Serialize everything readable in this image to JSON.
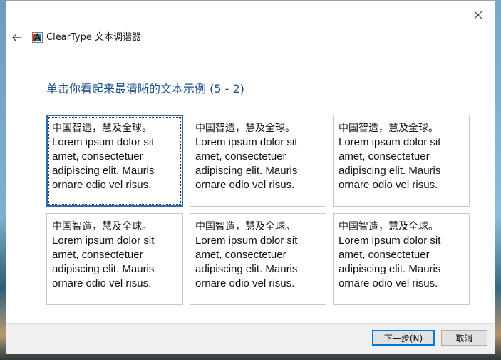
{
  "window": {
    "title": "ClearType 文本调谐器",
    "icon": "cleartype-app-icon",
    "back_icon": "back-arrow-icon",
    "close_icon": "close-icon"
  },
  "heading": "单击你看起来最清晰的文本示例 (5 - 2)",
  "samples": [
    {
      "cn": "中国智造，慧及全球。",
      "en": "Lorem ipsum dolor sit amet, consectetuer adipiscing elit. Mauris ornare odio vel risus.",
      "selected": true
    },
    {
      "cn": "中国智造，慧及全球。",
      "en": "Lorem ipsum dolor sit amet, consectetuer adipiscing elit. Mauris ornare odio vel risus.",
      "selected": false
    },
    {
      "cn": "中国智造，慧及全球。",
      "en": "Lorem ipsum dolor sit amet, consectetuer adipiscing elit. Mauris ornare odio vel risus.",
      "selected": false
    },
    {
      "cn": "中国智造，慧及全球。",
      "en": "Lorem ipsum dolor sit amet, consectetuer adipiscing elit. Mauris ornare odio vel risus.",
      "selected": false
    },
    {
      "cn": "中国智造，慧及全球。",
      "en": "Lorem ipsum dolor sit amet, consectetuer adipiscing elit. Mauris ornare odio vel risus.",
      "selected": false
    },
    {
      "cn": "中国智造，慧及全球。",
      "en": "Lorem ipsum dolor sit amet, consectetuer adipiscing elit. Mauris ornare odio vel risus.",
      "selected": false
    }
  ],
  "footer": {
    "next_label": "下一步(N)",
    "cancel_label": "取消"
  },
  "colors": {
    "heading": "#1a4f8b",
    "selection_border": "#2b6cb0",
    "default_button_border": "#0078d7"
  }
}
